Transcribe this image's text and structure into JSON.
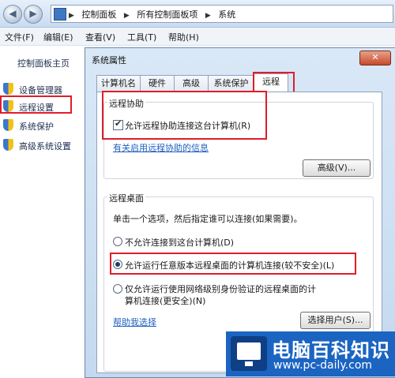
{
  "address": {
    "crumbs": [
      "控制面板",
      "所有控制面板项",
      "系统"
    ]
  },
  "menu": {
    "file": "文件(F)",
    "edit": "编辑(E)",
    "view": "查看(V)",
    "tools": "工具(T)",
    "help": "帮助(H)"
  },
  "left_pane": {
    "home": "控制面板主页",
    "items": [
      "设备管理器",
      "远程设置",
      "系统保护",
      "高级系统设置"
    ]
  },
  "dialog": {
    "title": "系统属性",
    "close_glyph": "✕",
    "tabs": [
      "计算机名",
      "硬件",
      "高级",
      "系统保护",
      "远程"
    ],
    "remote_assistance": {
      "group_title": "远程协助",
      "checkbox_label": "允许远程协助连接这台计算机(R)",
      "checkbox_checked": true,
      "info_link": "有关启用远程协助的信息",
      "advanced_button": "高级(V)..."
    },
    "remote_desktop": {
      "group_title": "远程桌面",
      "instruction": "单击一个选项，然后指定谁可以连接(如果需要)。",
      "options": [
        "不允许连接到这台计算机(D)",
        "允许运行任意版本远程桌面的计算机连接(较不安全)(L)",
        "仅允许运行使用网络级别身份验证的远程桌面的计算机连接(更安全)(N)"
      ],
      "selected_option": 1,
      "help_link": "帮助我选择",
      "select_users_button": "选择用户(S)..."
    }
  },
  "watermark": {
    "title": "电脑百科知识",
    "url": "www.pc-daily.com"
  }
}
